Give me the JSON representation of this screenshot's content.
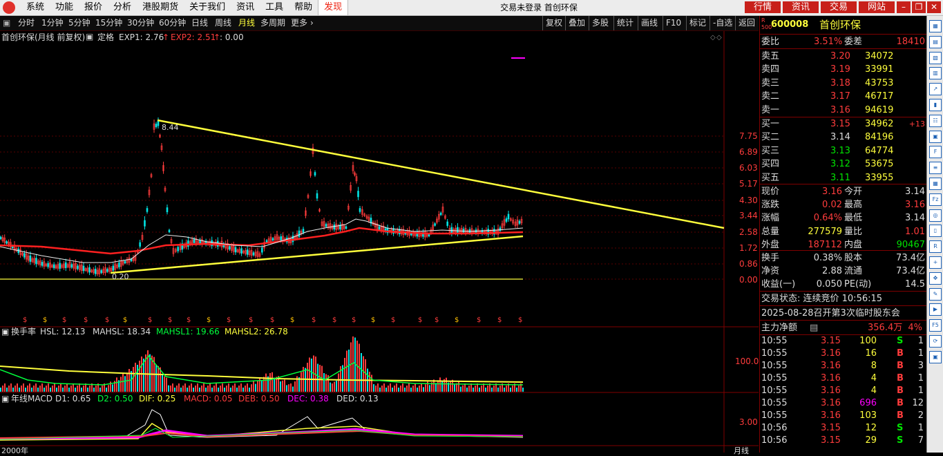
{
  "menubar": {
    "items": [
      "系统",
      "功能",
      "报价",
      "分析",
      "港股期货",
      "关于我们",
      "资讯",
      "工具",
      "帮助",
      "发现"
    ],
    "title": "交易未登录  首创环保",
    "right_buttons": [
      "行情",
      "资讯",
      "交易",
      "网站"
    ]
  },
  "periodbar": {
    "tabs": [
      "分时",
      "1分钟",
      "5分钟",
      "15分钟",
      "30分钟",
      "60分钟",
      "日线",
      "周线",
      "月线",
      "多周期",
      "更多"
    ],
    "active": "月线",
    "tools": [
      "复权",
      "叠加",
      "多股",
      "统计",
      "画线",
      "F10",
      "标记",
      "-自选",
      "返回"
    ]
  },
  "main_legend": {
    "title": "首创环保(月线 前复权)",
    "dinge": "定格",
    "exp1": "EXP1: 2.76",
    "exp2": "EXP2: 2.51",
    "extra": ": 0.00"
  },
  "price_axis": [
    "7.75",
    "6.89",
    "6.03",
    "5.17",
    "4.30",
    "3.44",
    "2.58",
    "1.72",
    "0.86",
    "0.00"
  ],
  "annotations": {
    "high": "8.44",
    "low": "0.20"
  },
  "hsl_legend": {
    "name": "换手率",
    "hsl": "HSL: 12.13",
    "mahsl": "MAHSL: 18.34",
    "mahsl1": "MAHSL1: 19.66",
    "mahsl2": "MAHSL2: 26.78",
    "axis": "100.0"
  },
  "macd_legend": {
    "name": "年线MACD",
    "d1": "D1: 0.65",
    "d2": "D2: 0.50",
    "dif": "DIF: 0.25",
    "macd": "MACD: 0.05",
    "deb": "DEB: 0.50",
    "dec": "DEC: 0.38",
    "ded": "DED: 0.13",
    "axis": "3.00"
  },
  "time_axis": {
    "start": "2000年",
    "right": "月线"
  },
  "quote": {
    "code": "600008",
    "name": "首创环保",
    "weibi_label": "委比",
    "weibi": "3.51%",
    "weicha_label": "委差",
    "weicha": "18410",
    "asks": [
      {
        "label": "卖五",
        "price": "3.20",
        "vol": "34072"
      },
      {
        "label": "卖四",
        "price": "3.19",
        "vol": "33991"
      },
      {
        "label": "卖三",
        "price": "3.18",
        "vol": "43753"
      },
      {
        "label": "卖二",
        "price": "3.17",
        "vol": "46717"
      },
      {
        "label": "卖一",
        "price": "3.16",
        "vol": "94619"
      }
    ],
    "bids": [
      {
        "label": "买一",
        "price": "3.15",
        "vol": "34962",
        "chg": "+13"
      },
      {
        "label": "买二",
        "price": "3.14",
        "vol": "84196",
        "chg": ""
      },
      {
        "label": "买三",
        "price": "3.13",
        "vol": "64774",
        "chg": ""
      },
      {
        "label": "买四",
        "price": "3.12",
        "vol": "53675",
        "chg": ""
      },
      {
        "label": "买五",
        "price": "3.11",
        "vol": "33955",
        "chg": ""
      }
    ],
    "stats": [
      [
        "现价",
        "3.16",
        "今开",
        "3.14"
      ],
      [
        "涨跌",
        "0.02",
        "最高",
        "3.16"
      ],
      [
        "涨幅",
        "0.64%",
        "最低",
        "3.14"
      ],
      [
        "总量",
        "277579",
        "量比",
        "1.01"
      ],
      [
        "外盘",
        "187112",
        "内盘",
        "90467"
      ]
    ],
    "stats2": [
      [
        "换手",
        "0.38%",
        "股本",
        "73.4亿"
      ],
      [
        "净资",
        "2.88",
        "流通",
        "73.4亿"
      ],
      [
        "收益(一)",
        "0.050",
        "PE(动)",
        "14.5"
      ]
    ],
    "status": "交易状态: 连续竞价 10:56:15",
    "news": "2025-08-28召开第3次临时股东会",
    "mainflow_label": "主力净额",
    "mainflow": "356.4万",
    "mainflow_pct": "4%",
    "ticks": [
      {
        "t": "10:55",
        "p": "3.15",
        "v": "100",
        "bs": "S",
        "n": "1"
      },
      {
        "t": "10:55",
        "p": "3.16",
        "v": "16",
        "bs": "B",
        "n": "1"
      },
      {
        "t": "10:55",
        "p": "3.16",
        "v": "8",
        "bs": "B",
        "n": "3"
      },
      {
        "t": "10:55",
        "p": "3.16",
        "v": "4",
        "bs": "B",
        "n": "1"
      },
      {
        "t": "10:55",
        "p": "3.16",
        "v": "4",
        "bs": "B",
        "n": "1"
      },
      {
        "t": "10:55",
        "p": "3.16",
        "v": "696",
        "bs": "B",
        "n": "12"
      },
      {
        "t": "10:55",
        "p": "3.16",
        "v": "103",
        "bs": "B",
        "n": "2"
      },
      {
        "t": "10:56",
        "p": "3.15",
        "v": "12",
        "bs": "S",
        "n": "1"
      },
      {
        "t": "10:56",
        "p": "3.15",
        "v": "29",
        "bs": "S",
        "n": "7"
      }
    ]
  },
  "colors": {
    "up": "#ff3c3c",
    "down": "#00e4e4",
    "yellow": "#ffff3c",
    "panelBorder": "#800000"
  }
}
